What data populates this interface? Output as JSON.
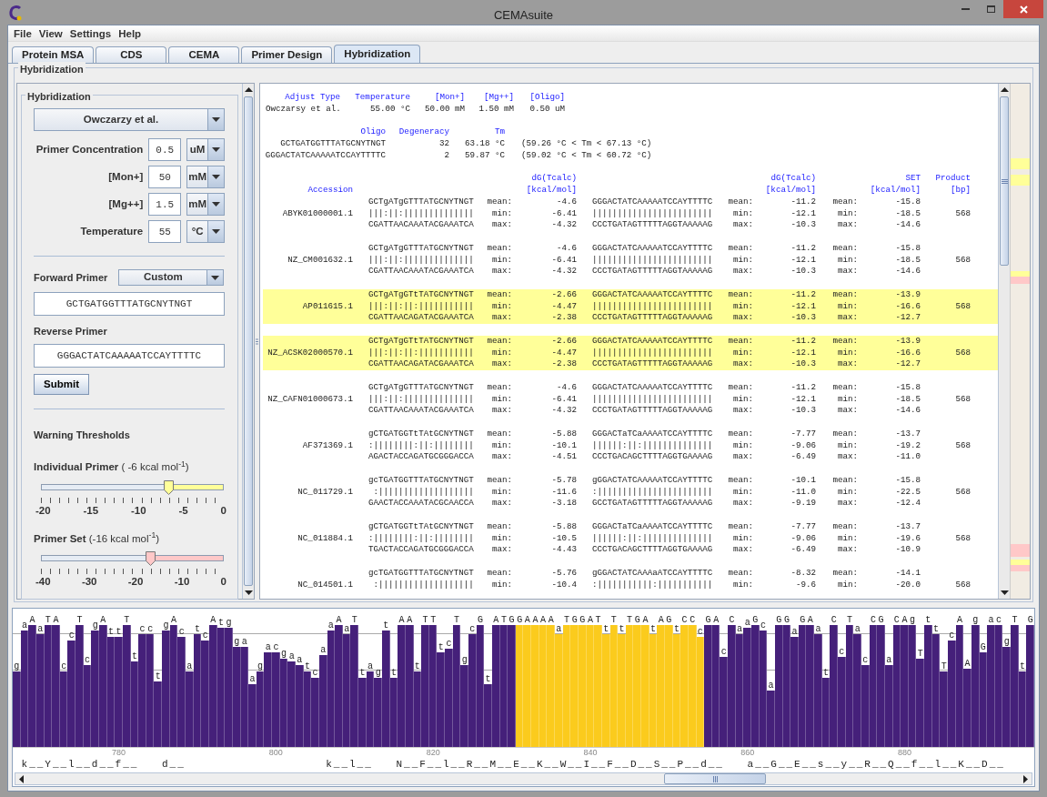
{
  "window": {
    "title": "CEMAsuite"
  },
  "menu": [
    "File",
    "View",
    "Settings",
    "Help"
  ],
  "tabs": [
    {
      "label": "Protein MSA",
      "selected": false
    },
    {
      "label": "CDS",
      "selected": false
    },
    {
      "label": "CEMA",
      "selected": false
    },
    {
      "label": "Primer Design",
      "selected": false
    },
    {
      "label": "Hybridization",
      "selected": true
    }
  ],
  "panel_title": "Hybridization",
  "settings": {
    "title": "Hybridization",
    "method": "Owczarzy et al.",
    "params": [
      {
        "label": "Primer Concentration",
        "value": "0.5",
        "unit": "uM"
      },
      {
        "label": "[Mon+]",
        "value": "50",
        "unit": "mM"
      },
      {
        "label": "[Mg++]",
        "value": "1.5",
        "unit": "mM"
      },
      {
        "label": "Temperature",
        "value": "55",
        "unit": "°C"
      }
    ],
    "forward": {
      "label": "Forward Primer",
      "mode": "Custom",
      "value": "GCTGATGGTTTATGCNYTNGT"
    },
    "reverse": {
      "label": "Reverse Primer",
      "value": "GGGACTATCAAAAATCCAYTTTTC"
    },
    "submit": "Submit",
    "thresholds_title": "Warning Thresholds",
    "sliders": [
      {
        "label": "**Individual Primer** ( -6 kcal mol$^{-1}$)",
        "level": 0.7,
        "color": "#ffff99",
        "ticks": [
          "-20",
          "-15",
          "-10",
          "-5",
          "0"
        ]
      },
      {
        "label": "**Primer Set** (-16 kcal mol$^{-1}$)",
        "level": 0.6,
        "color": "#ffc8c8",
        "ticks": [
          "-40",
          "-30",
          "-20",
          "-10",
          "0"
        ]
      }
    ]
  },
  "results": {
    "conditions": {
      "columns": [
        "Adjust Type",
        "Temperature",
        "[Mon+]",
        "[Mg++]",
        "[Oligo]"
      ],
      "values": [
        "Owczarsy et al.",
        "55.00 °C",
        "50.00 mM",
        "1.50 mM",
        "0.50 uM"
      ]
    },
    "oligos": {
      "columns": [
        "Oligo",
        "Degeneracy",
        "Tm"
      ],
      "rows": [
        {
          "oligo": "GCTGATGGTTTATGCNYTNGT",
          "degeneracy": "32",
          "tm": "63.18 °C",
          "range": "(59.26 °C < Tm < 67.13 °C)"
        },
        {
          "oligo": "GGGACTATCAAAAATCCAYTTTTC",
          "degeneracy": "2",
          "tm": "59.87 °C",
          "range": "(59.02 °C < Tm < 60.72 °C)"
        }
      ]
    },
    "hit_header": {
      "accession": "Accession",
      "fwd_dg": [
        "dG(Tcalc)",
        "[kcal/mol]"
      ],
      "rev_dg": [
        "dG(Tcalc)",
        "[kcal/mol]"
      ],
      "set": [
        "SET",
        "[kcal/mol]"
      ],
      "product": [
        "Product",
        "[bp]"
      ]
    },
    "hits": [
      {
        "accession": "ABYK01000001.1",
        "highlighted": false,
        "fwd": [
          "GCTgATgGTTTATGCNYTNGT",
          "|||:||:||||||||||||||",
          "CGATTAACAAATACGAAATCA"
        ],
        "fwd_stats": [
          [
            "mean:",
            "-4.6"
          ],
          [
            "min:",
            "-6.41"
          ],
          [
            "max:",
            "-4.32"
          ]
        ],
        "rev": [
          "GGGACTATCAAAAATCCAYTTTTC",
          "||||||||||||||||||||||||",
          "CCCTGATAGTTTTTAGGTAAAAAG"
        ],
        "rev_stats": [
          [
            "mean:",
            "-11.2"
          ],
          [
            "min:",
            "-12.1"
          ],
          [
            "max:",
            "-10.3"
          ]
        ],
        "set_stats": [
          [
            "mean:",
            "-15.8"
          ],
          [
            "min:",
            "-18.5"
          ],
          [
            "max:",
            "-14.6"
          ]
        ],
        "product": "568"
      },
      {
        "accession": "NZ_CM001632.1",
        "highlighted": false,
        "fwd": [
          "GCTgATgGTTTATGCNYTNGT",
          "|||:||:||||||||||||||",
          "CGATTAACAAATACGAAATCA"
        ],
        "fwd_stats": [
          [
            "mean:",
            "-4.6"
          ],
          [
            "min:",
            "-6.41"
          ],
          [
            "max:",
            "-4.32"
          ]
        ],
        "rev": [
          "GGGACTATCAAAAATCCAYTTTTC",
          "||||||||||||||||||||||||",
          "CCCTGATAGTTTTTAGGTAAAAAG"
        ],
        "rev_stats": [
          [
            "mean:",
            "-11.2"
          ],
          [
            "min:",
            "-12.1"
          ],
          [
            "max:",
            "-10.3"
          ]
        ],
        "set_stats": [
          [
            "mean:",
            "-15.8"
          ],
          [
            "min:",
            "-18.5"
          ],
          [
            "max:",
            "-14.6"
          ]
        ],
        "product": "568"
      },
      {
        "accession": "AP011615.1",
        "highlighted": true,
        "fwd": [
          "GCTgATgGTtTATGCNYTNGT",
          "|||:||:||:|||||||||||",
          "CGATTAACAGATACGAAATCA"
        ],
        "fwd_stats": [
          [
            "mean:",
            "-2.66"
          ],
          [
            "min:",
            "-4.47"
          ],
          [
            "max:",
            "-2.38"
          ]
        ],
        "rev": [
          "GGGACTATCAAAAATCCAYTTTTC",
          "||||||||||||||||||||||||",
          "CCCTGATAGTTTTTAGGTAAAAAG"
        ],
        "rev_stats": [
          [
            "mean:",
            "-11.2"
          ],
          [
            "min:",
            "-12.1"
          ],
          [
            "max:",
            "-10.3"
          ]
        ],
        "set_stats": [
          [
            "mean:",
            "-13.9"
          ],
          [
            "min:",
            "-16.6"
          ],
          [
            "max:",
            "-12.7"
          ]
        ],
        "product": "568"
      },
      {
        "accession": "NZ_ACSK02000570.1",
        "highlighted": true,
        "fwd": [
          "GCTgATgGTtTATGCNYTNGT",
          "|||:||:||:|||||||||||",
          "CGATTAACAGATACGAAATCA"
        ],
        "fwd_stats": [
          [
            "mean:",
            "-2.66"
          ],
          [
            "min:",
            "-4.47"
          ],
          [
            "max:",
            "-2.38"
          ]
        ],
        "rev": [
          "GGGACTATCAAAAATCCAYTTTTC",
          "||||||||||||||||||||||||",
          "CCCTGATAGTTTTTAGGTAAAAAG"
        ],
        "rev_stats": [
          [
            "mean:",
            "-11.2"
          ],
          [
            "min:",
            "-12.1"
          ],
          [
            "max:",
            "-10.3"
          ]
        ],
        "set_stats": [
          [
            "mean:",
            "-13.9"
          ],
          [
            "min:",
            "-16.6"
          ],
          [
            "max:",
            "-12.7"
          ]
        ],
        "product": "568"
      },
      {
        "accession": "NZ_CAFN01000673.1",
        "highlighted": false,
        "fwd": [
          "GCTgATgGTTTATGCNYTNGT",
          "|||:||:||||||||||||||",
          "CGATTAACAAATACGAAATCA"
        ],
        "fwd_stats": [
          [
            "mean:",
            "-4.6"
          ],
          [
            "min:",
            "-6.41"
          ],
          [
            "max:",
            "-4.32"
          ]
        ],
        "rev": [
          "GGGACTATCAAAAATCCAYTTTTC",
          "||||||||||||||||||||||||",
          "CCCTGATAGTTTTTAGGTAAAAAG"
        ],
        "rev_stats": [
          [
            "mean:",
            "-11.2"
          ],
          [
            "min:",
            "-12.1"
          ],
          [
            "max:",
            "-10.3"
          ]
        ],
        "set_stats": [
          [
            "mean:",
            "-15.8"
          ],
          [
            "min:",
            "-18.5"
          ],
          [
            "max:",
            "-14.6"
          ]
        ],
        "product": "568"
      },
      {
        "accession": "AF371369.1",
        "highlighted": false,
        "fwd": [
          "gCTGATGGTtTAtGCNYTNGT",
          ":||||||||:||:||||||||",
          "AGACTACCAGATGCGGGACCA"
        ],
        "fwd_stats": [
          [
            "mean:",
            "-5.88"
          ],
          [
            "min:",
            "-10.1"
          ],
          [
            "max:",
            "-4.51"
          ]
        ],
        "rev": [
          "GGGACTaTCaAAAATCCAYTTTTC",
          "||||||:||:||||||||||||||",
          "CCCTGACAGCTTTTAGGTGAAAAG"
        ],
        "rev_stats": [
          [
            "mean:",
            "-7.77"
          ],
          [
            "min:",
            "-9.06"
          ],
          [
            "max:",
            "-6.49"
          ]
        ],
        "set_stats": [
          [
            "mean:",
            "-13.7"
          ],
          [
            "min:",
            "-19.2"
          ],
          [
            "max:",
            "-11.0"
          ]
        ],
        "product": "568"
      },
      {
        "accession": "NC_011729.1",
        "highlighted": false,
        "fwd": [
          "gcTGATGGTTTATGCNYTNGT",
          " :|||||||||||||||||||",
          "GAACTACCAAATACGCAACCA"
        ],
        "fwd_stats": [
          [
            "mean:",
            "-5.78"
          ],
          [
            "min:",
            "-11.6"
          ],
          [
            "max:",
            "-3.18"
          ]
        ],
        "rev": [
          "gGGACTATCAAAAATCCAYTTTTC",
          ":|||||||||||||||||||||||",
          "GCCTGATAGTTTTTAGGTAAAAAG"
        ],
        "rev_stats": [
          [
            "mean:",
            "-10.1"
          ],
          [
            "min:",
            "-11.0"
          ],
          [
            "max:",
            "-9.19"
          ]
        ],
        "set_stats": [
          [
            "mean:",
            "-15.8"
          ],
          [
            "min:",
            "-22.5"
          ],
          [
            "max:",
            "-12.4"
          ]
        ],
        "product": "568"
      },
      {
        "accession": "NC_011884.1",
        "highlighted": false,
        "fwd": [
          "gCTGATGGTtTAtGCNYTNGT",
          ":||||||||:||:||||||||",
          "TGACTACCAGATGCGGGACCA"
        ],
        "fwd_stats": [
          [
            "mean:",
            "-5.88"
          ],
          [
            "min:",
            "-10.5"
          ],
          [
            "max:",
            "-4.43"
          ]
        ],
        "rev": [
          "GGGACTaTCaAAAATCCAYTTTTC",
          "||||||:||:||||||||||||||",
          "CCCTGACAGCTTTTAGGTGAAAAG"
        ],
        "rev_stats": [
          [
            "mean:",
            "-7.77"
          ],
          [
            "min:",
            "-9.06"
          ],
          [
            "max:",
            "-6.49"
          ]
        ],
        "set_stats": [
          [
            "mean:",
            "-13.7"
          ],
          [
            "min:",
            "-19.6"
          ],
          [
            "max:",
            "-10.9"
          ]
        ],
        "product": "568"
      },
      {
        "accession": "NC_014501.1",
        "highlighted": false,
        "fwd": [
          "gcTGATGGTTTATGCNYTNGT",
          " :|||||||||||||||||||"
        ],
        "fwd_stats": [
          [
            "mean:",
            "-5.76"
          ],
          [
            "min:",
            "-10.4"
          ]
        ],
        "rev": [
          "gGGACTATCAAAaATCCAYTTTTC",
          ":|||||||||||:|||||||||||"
        ],
        "rev_stats": [
          [
            "mean:",
            "-8.32"
          ],
          [
            "min:",
            "-9.6"
          ]
        ],
        "set_stats": [
          [
            "mean:",
            "-14.1"
          ],
          [
            "min:",
            "-20.0"
          ]
        ],
        "product": "568"
      }
    ]
  },
  "alignment": {
    "segments": [
      {
        "kind": "plain",
        "bases": [
          "g",
          "a",
          "A",
          "a",
          "T",
          "A",
          "c",
          "c",
          "T",
          "c",
          "g",
          "A",
          "t",
          "t",
          "T",
          "t",
          "c",
          "c",
          "t",
          "g",
          "A",
          "c",
          "a",
          "t",
          "c",
          "A",
          "t",
          "g",
          "g",
          "a",
          "a",
          "g",
          "a",
          "c",
          "g",
          "a",
          "a",
          "t",
          "c",
          "a",
          "a",
          "A",
          "a",
          "T",
          "t",
          "a",
          "g",
          "t",
          "t",
          "A",
          "A",
          "t",
          "T",
          "T",
          "t",
          "c",
          "T",
          "g",
          "c",
          "G",
          "t",
          "A",
          "T",
          "G"
        ]
      },
      {
        "kind": "primer",
        "bases": [
          "G",
          "A",
          "A",
          "A",
          "A",
          "a",
          "T",
          "G",
          "G",
          "A",
          "T",
          "t",
          "T",
          "t",
          "T",
          "G",
          "A",
          "t",
          "A",
          "G",
          "t",
          "C",
          "C",
          "c"
        ]
      },
      {
        "kind": "plain",
        "bases": [
          "G",
          "A",
          "c",
          "C",
          "a",
          "a",
          "G",
          "c",
          "a",
          "G",
          "G",
          "a",
          "G",
          "A",
          "a",
          "t",
          "C",
          "c",
          "T",
          "a",
          "c",
          "C",
          "G",
          "a",
          "C",
          "A",
          "g",
          "T",
          "t",
          "t",
          "T",
          "c",
          "A",
          "A",
          "g",
          "G",
          "a",
          "c",
          "g",
          "T",
          "t",
          "G"
        ]
      }
    ],
    "positions": [
      "780",
      "800",
      "820",
      "840",
      "860",
      "880"
    ],
    "translation": " k__Y__l__d__f__   d__                  k__l__   N__F__l__R__M__E__K__W__I__F__D__S__P__d__   a__G__E__s__y__R__Q__f__l__K__D__"
  }
}
